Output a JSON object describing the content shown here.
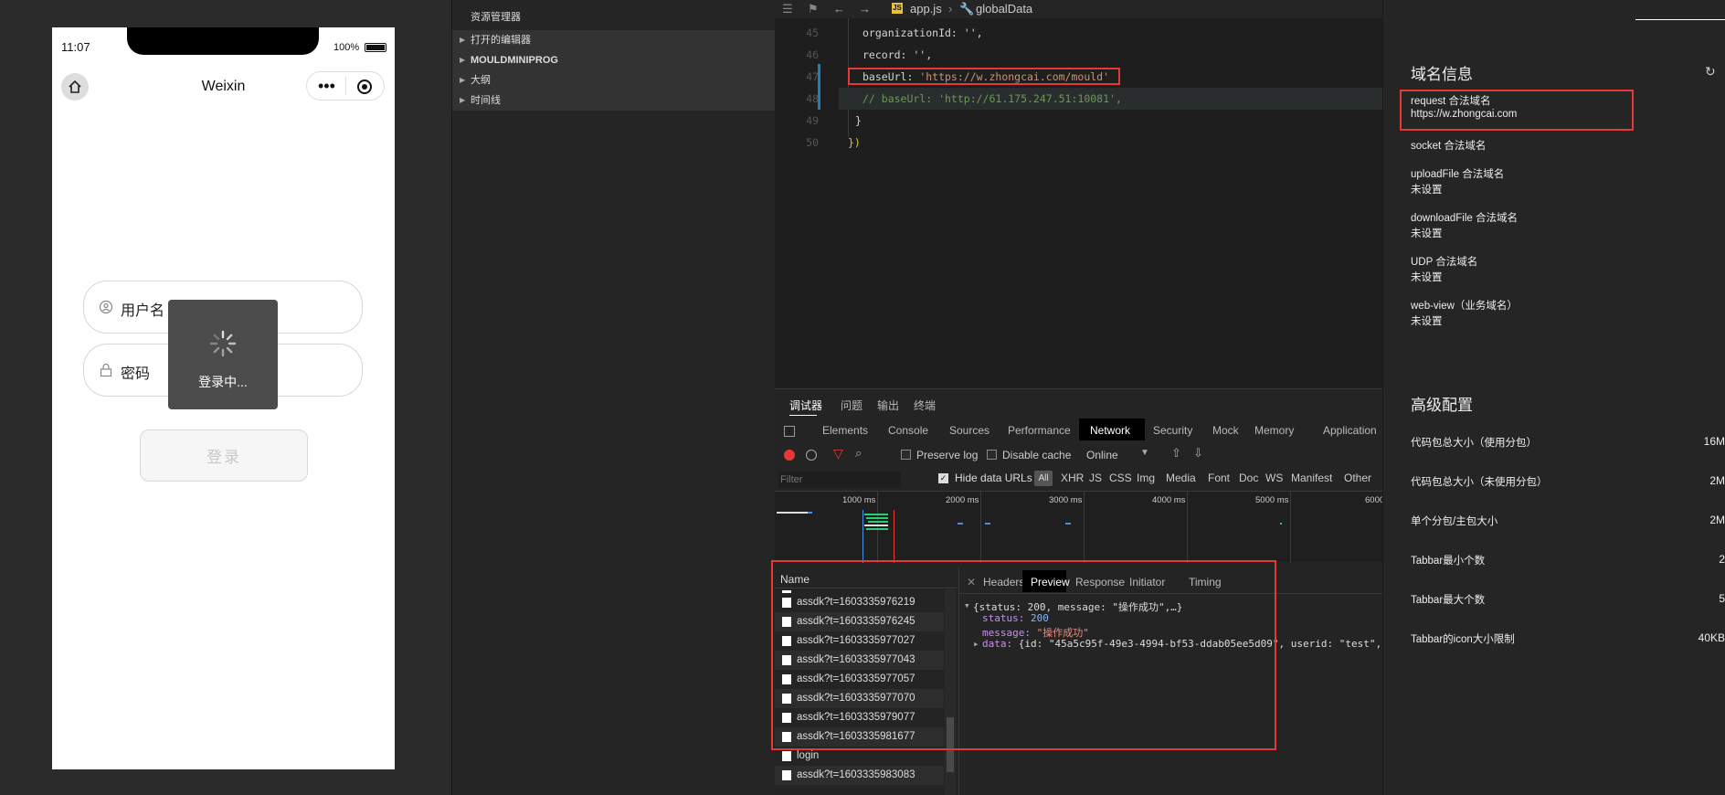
{
  "simulator": {
    "time": "11:07",
    "battery": "100%",
    "nav_title": "Weixin",
    "username_placeholder": "用户名",
    "password_placeholder": "密码",
    "toast_text": "登录中...",
    "login_button": "登录"
  },
  "explorer": {
    "title": "资源管理器",
    "sections": [
      "打开的编辑器",
      "MOULDMINIPROG",
      "大纲",
      "时间线"
    ]
  },
  "editor": {
    "breadcrumb": {
      "file": "app.js",
      "symbol": "globalData"
    },
    "lines": [
      {
        "num": "45",
        "code": "organizationId: '',"
      },
      {
        "num": "46",
        "code": "record: '',"
      },
      {
        "num": "47",
        "key": "baseUrl: ",
        "str": "'https://w.zhongcai.com/mould'"
      },
      {
        "num": "48",
        "comment": "// baseUrl: 'http://61.175.247.51:10081',"
      },
      {
        "num": "49",
        "code": "}"
      },
      {
        "num": "50",
        "code": "})"
      }
    ]
  },
  "devtools": {
    "top_tabs": [
      "调试器",
      "问题",
      "输出",
      "终端"
    ],
    "panels": [
      "Elements",
      "Console",
      "Sources",
      "Performance",
      "Network",
      "Security",
      "Mock",
      "Memory",
      "Application"
    ],
    "active_panel": "Network",
    "toolbar": {
      "preserve_log": "Preserve log",
      "disable_cache": "Disable cache",
      "throttle": "Online"
    },
    "filter": {
      "placeholder": "Filter",
      "hide_data_urls": "Hide data URLs",
      "types": [
        "All",
        "XHR",
        "JS",
        "CSS",
        "Img",
        "Media",
        "Font",
        "Doc",
        "WS",
        "Manifest",
        "Other"
      ]
    },
    "timeline_labels": [
      "1000 ms",
      "2000 ms",
      "3000 ms",
      "4000 ms",
      "5000 ms",
      "6000"
    ],
    "name_header": "Name",
    "requests": [
      "assdk?t=1603335976219",
      "assdk?t=1603335976245",
      "assdk?t=1603335977027",
      "assdk?t=1603335977043",
      "assdk?t=1603335977057",
      "assdk?t=1603335977070",
      "assdk?t=1603335979077",
      "assdk?t=1603335981677",
      "login",
      "assdk?t=1603335983083"
    ],
    "detail_tabs": [
      "Headers",
      "Preview",
      "Response",
      "Initiator",
      "Timing"
    ],
    "active_detail_tab": "Preview",
    "preview": {
      "summary": "{status: 200, message: \"操作成功\",…}",
      "status_key": "status: ",
      "status_val": "200",
      "message_key": "message: ",
      "message_val": "\"操作成功\"",
      "data_key": "data: ",
      "data_val": "{id: \"45a5c95f-49e3-4994-bf53-ddab05ee5d09\", userid: \"test\","
    }
  },
  "project": {
    "domain_heading": "域名信息",
    "domains": [
      {
        "label": "request 合法域名",
        "value": "https://w.zhongcai.com"
      },
      {
        "label": "socket 合法域名",
        "value": ""
      },
      {
        "label": "uploadFile 合法域名",
        "value": "未设置"
      },
      {
        "label": "downloadFile 合法域名",
        "value": "未设置"
      },
      {
        "label": "UDP 合法域名",
        "value": "未设置"
      },
      {
        "label": "web-view（业务域名）",
        "value": "未设置"
      }
    ],
    "advanced_heading": "高级配置",
    "advanced": [
      {
        "label": "代码包总大小（使用分包）",
        "value": "16M"
      },
      {
        "label": "代码包总大小（未使用分包）",
        "value": "2M"
      },
      {
        "label": "单个分包/主包大小",
        "value": "2M"
      },
      {
        "label": "Tabbar最小个数",
        "value": "2"
      },
      {
        "label": "Tabbar最大个数",
        "value": "5"
      },
      {
        "label": "Tabbar的icon大小限制",
        "value": "40KB"
      }
    ]
  }
}
